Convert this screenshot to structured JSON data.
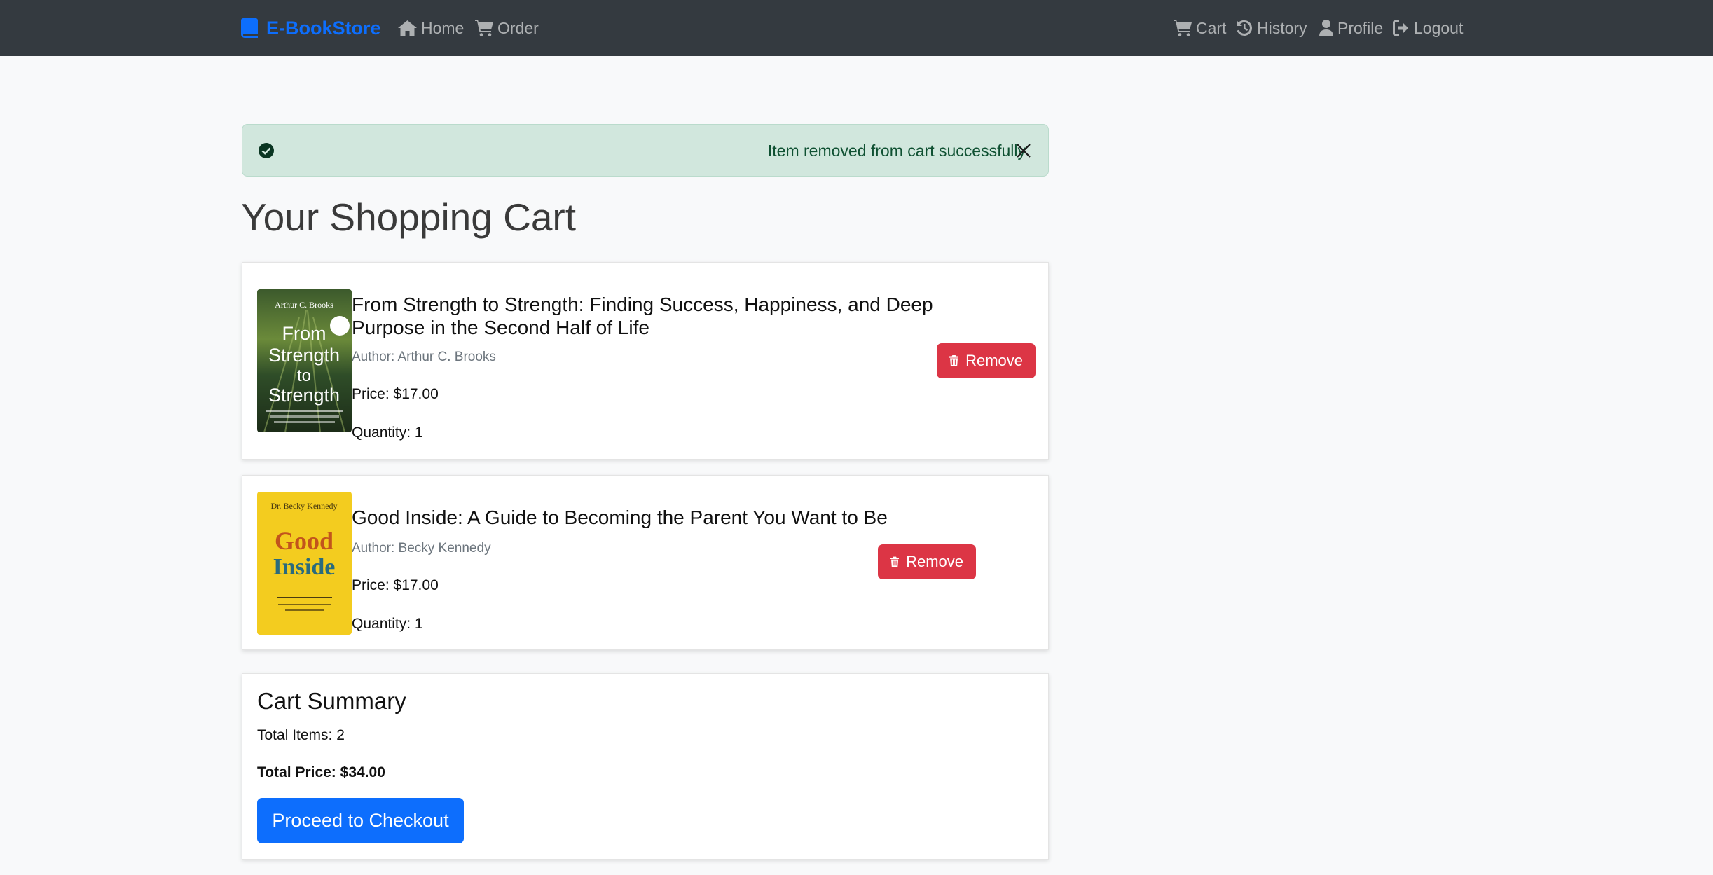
{
  "navbar": {
    "brand": "E-BookStore",
    "left_links": [
      {
        "label": "Home",
        "icon": "home-icon"
      },
      {
        "label": "Order",
        "icon": "cart-icon"
      }
    ],
    "right_links": [
      {
        "label": "Cart",
        "icon": "cart-icon"
      },
      {
        "label": "History",
        "icon": "history-icon"
      },
      {
        "label": "Profile",
        "icon": "user-icon"
      },
      {
        "label": "Logout",
        "icon": "logout-icon"
      }
    ]
  },
  "alert": {
    "message": "Item removed from cart successfully",
    "icon": "check-circle-icon",
    "close_icon": "close-icon"
  },
  "page_title": "Your Shopping Cart",
  "cart_items": [
    {
      "title": "From Strength to Strength: Finding Success, Happiness, and Deep Purpose in the Second Half of Life",
      "author": "Author: Arthur C. Brooks",
      "price": "Price: $17.00",
      "quantity": "Quantity: 1",
      "remove_label": "Remove",
      "cover": {
        "author_text": "Arthur C. Brooks",
        "title_text": "From Strength to Strength"
      }
    },
    {
      "title": "Good Inside: A Guide to Becoming the Parent You Want to Be",
      "author": "Author: Becky Kennedy",
      "price": "Price: $17.00",
      "quantity": "Quantity: 1",
      "remove_label": "Remove",
      "cover": {
        "author_text": "Dr. Becky Kennedy",
        "title_text": "Good Inside"
      }
    }
  ],
  "summary": {
    "title": "Cart Summary",
    "total_items": "Total Items: 2",
    "total_price": "Total Price: $34.00",
    "checkout_label": "Proceed to Checkout"
  },
  "colors": {
    "navbar_bg": "#343a40",
    "brand": "#0d6efd",
    "alert_bg": "#d1e7dd",
    "remove_button": "#dc3545",
    "checkout_button": "#0d6efd"
  }
}
